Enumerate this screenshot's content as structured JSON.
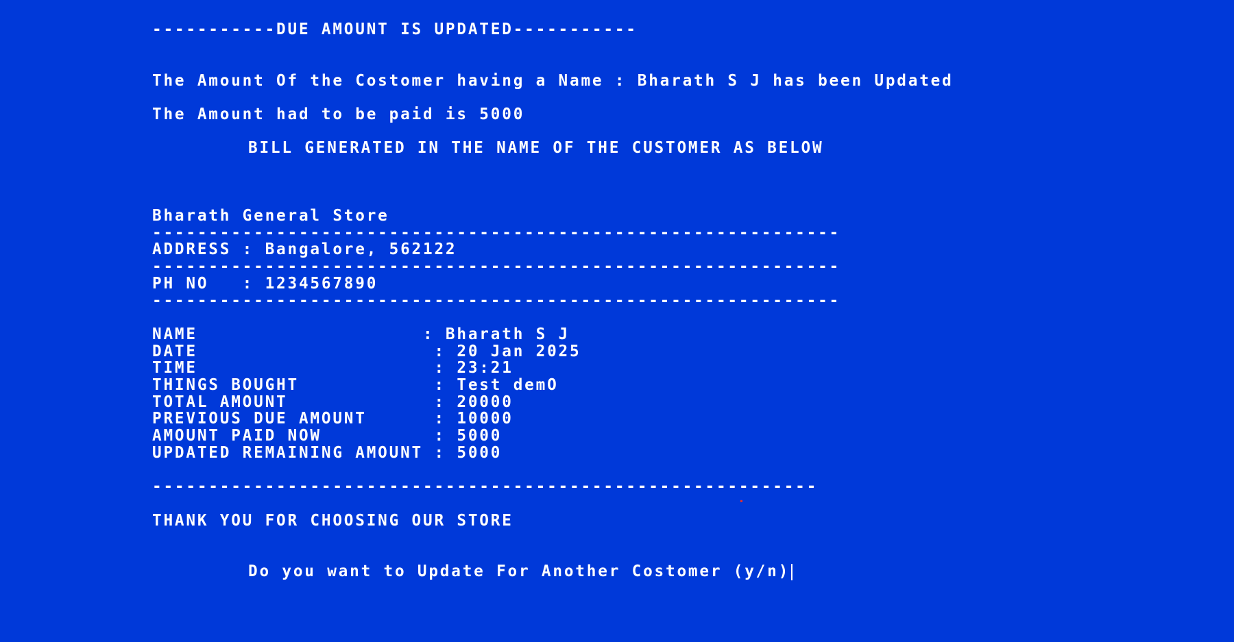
{
  "header": {
    "banner": "-----------DUE AMOUNT IS UPDATED-----------"
  },
  "messages": {
    "updated_line": "The Amount Of the Costomer having a Name : Bharath S J has been Updated",
    "due_line": "The Amount had to be paid is 5000",
    "bill_heading": "BILL GENERATED IN THE NAME OF THE CUSTOMER AS BELOW"
  },
  "store": {
    "name": "Bharath General Store",
    "address_line": "ADDRESS : Bangalore, 562122",
    "phone_line": "PH NO   : 1234567890",
    "separator": "-------------------------------------------------------------",
    "footer_separator": "-----------------------------------------------------------"
  },
  "bill": {
    "rows": [
      "NAME                    : Bharath S J",
      "DATE                     : 20 Jan 2025",
      "TIME                     : 23:21",
      "THINGS BOUGHT            : Test demO",
      "TOTAL AMOUNT             : 20000",
      "PREVIOUS DUE AMOUNT      : 10000",
      "AMOUNT PAID NOW          : 5000",
      "UPDATED REMAINING AMOUNT : 5000"
    ]
  },
  "footer": {
    "thanks": "THANK YOU FOR CHOOSING OUR STORE",
    "prompt": "Do you want to Update For Another Costomer (y/n)"
  },
  "colors": {
    "background": "#0039d9",
    "text": "#ffffff"
  }
}
